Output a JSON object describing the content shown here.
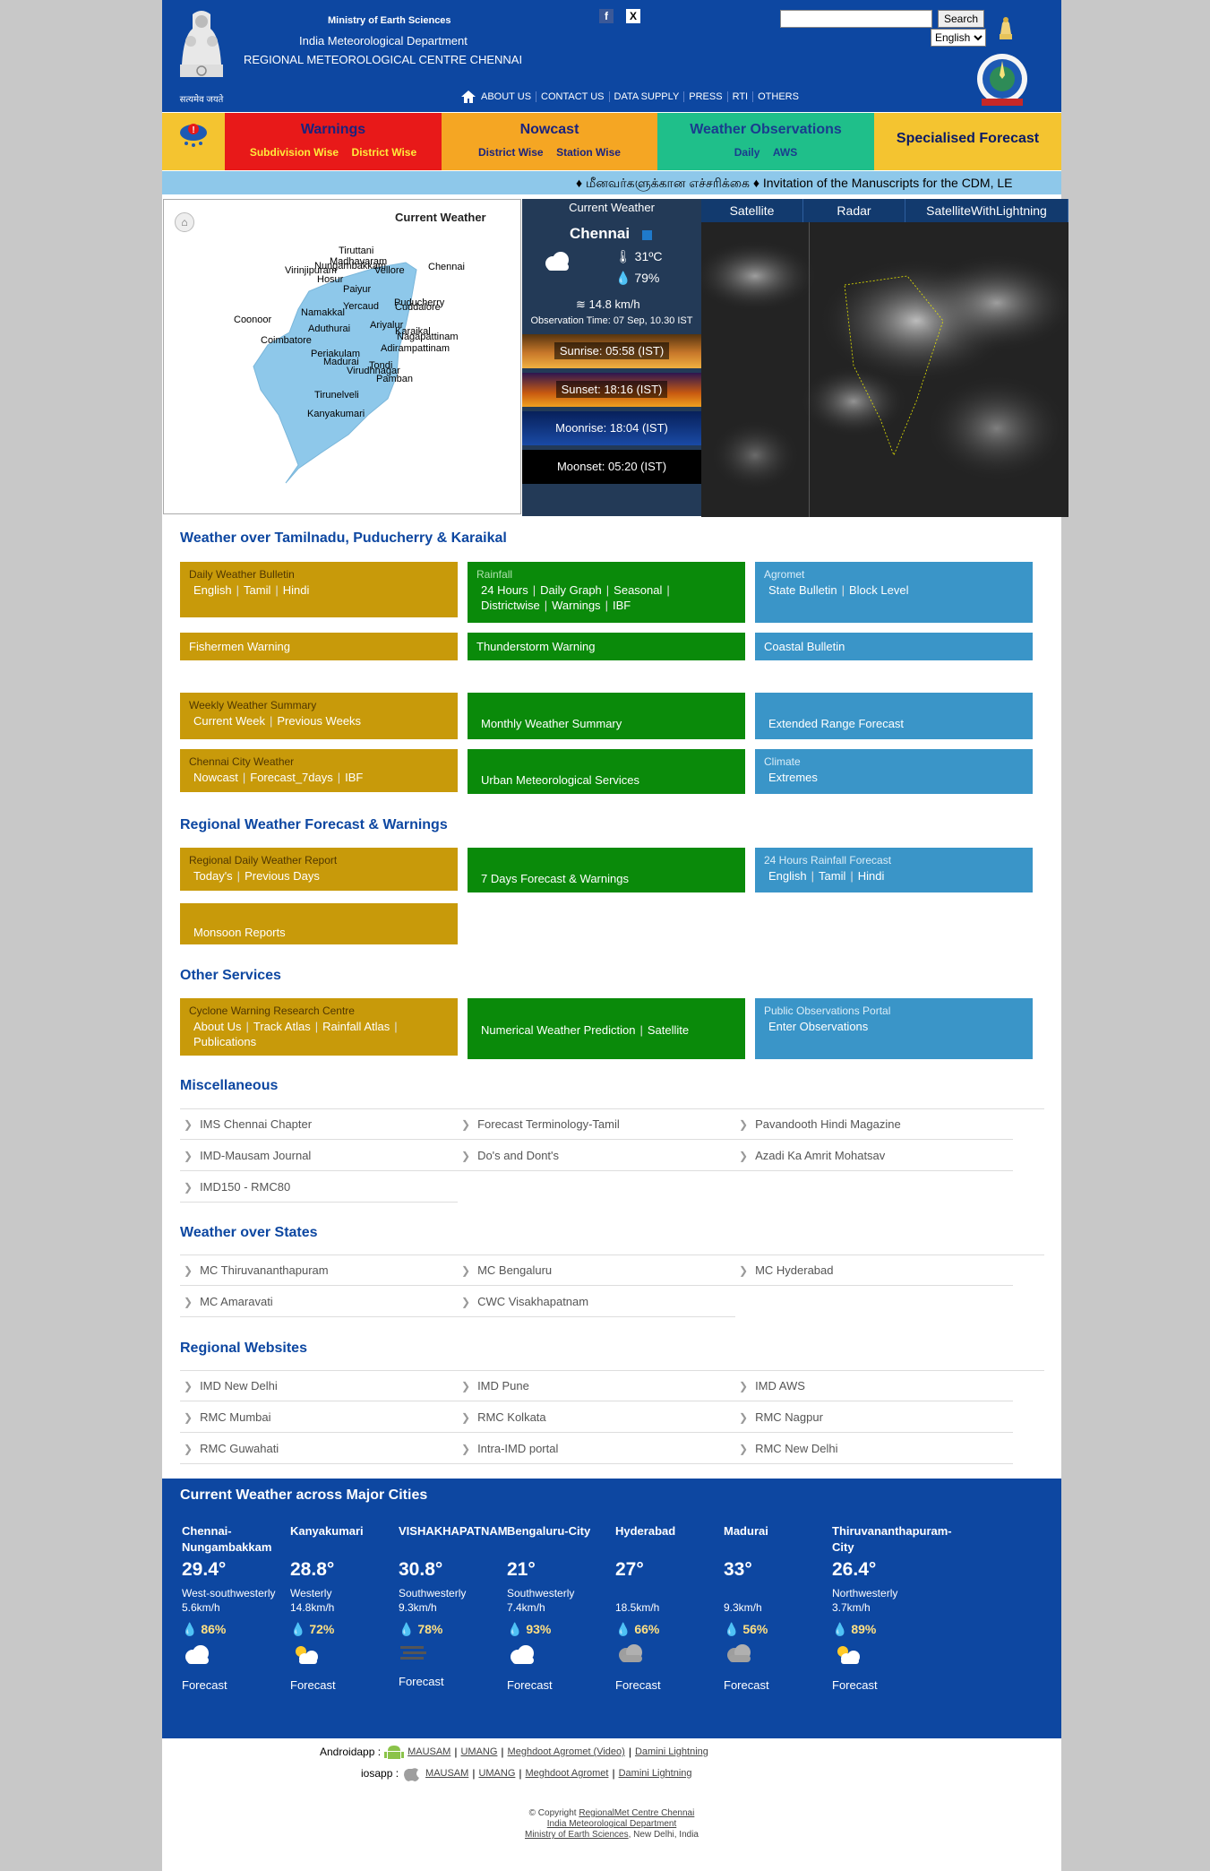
{
  "header": {
    "ministry": "Ministry of Earth Sciences",
    "department": "India Meteorological Department",
    "centre": "REGIONAL METEOROLOGICAL CENTRE CHENNAI",
    "emblem_motto": "सत्यमेव जयते",
    "social": [
      {
        "icon": "facebook-icon",
        "glyph": "f"
      },
      {
        "icon": "x-twitter-icon",
        "glyph": "X"
      }
    ],
    "search_button": "Search",
    "language": "English",
    "nav": [
      "ABOUT US",
      "CONTACT US",
      "DATA SUPPLY",
      "PRESS",
      "RTI",
      "OTHERS"
    ]
  },
  "categories": [
    {
      "title": "Warnings",
      "links": [
        "Subdivision Wise",
        "District Wise"
      ],
      "color": "#e81919"
    },
    {
      "title": "Nowcast",
      "links": [
        "District Wise",
        "Station Wise"
      ],
      "color": "#f5a623"
    },
    {
      "title": "Weather Observations",
      "links": [
        "Daily",
        "AWS"
      ],
      "color": "#1fbf8a"
    },
    {
      "title": "Specialised Forecast",
      "links": [],
      "color": "#f4c430"
    }
  ],
  "ticker": "♦ மீனவர்களுக்கான எச்சரிக்கை   ♦ Invitation of the Manuscripts for the CDM, LE",
  "map": {
    "title": "Current Weather",
    "places": [
      "Tiruttani",
      "Madhavaram",
      "Nungambakkam",
      "Virinjipuram",
      "Vellore",
      "Chennai",
      "Hosur",
      "Paiyur",
      "Yercaud",
      "Puducherry",
      "Cuddalore",
      "Namakkal",
      "Coonoor",
      "Ariyalur",
      "Aduthurai",
      "Karaikal",
      "Nagapattinam",
      "Coimbatore",
      "Adirampattinam",
      "Periakulam",
      "Madurai",
      "Tondi",
      "Virudhnagar",
      "Pamban",
      "Tirunelveli",
      "Kanyakumari"
    ]
  },
  "current": {
    "title": "Current Weather",
    "city": "Chennai",
    "temp": "31ºC",
    "humidity": "79%",
    "wind": "14.8 km/h",
    "obs_time": "Observation Time: 07 Sep, 10.30 IST",
    "sunrise": "Sunrise: 05:58 (IST)",
    "sunset": "Sunset: 18:16 (IST)",
    "moonrise": "Moonrise: 18:04 (IST)",
    "moonset": "Moonset: 05:20 (IST)"
  },
  "sat_tabs": [
    "Satellite",
    "Radar",
    "SatelliteWithLightning"
  ],
  "sections": {
    "tamilnadu": "Weather over Tamilnadu, Puducherry & Karaikal",
    "regional": "Regional Weather Forecast & Warnings",
    "other": "Other Services",
    "misc": "Miscellaneous",
    "states": "Weather over States",
    "websites": "Regional Websites"
  },
  "tn_boxes": {
    "daily_bulletin": {
      "head": "Daily Weather Bulletin",
      "links": [
        "English",
        "Tamil",
        "Hindi"
      ]
    },
    "rainfall": {
      "head": "Rainfall",
      "links": [
        "24 Hours",
        "Daily Graph",
        "Seasonal",
        "Districtwise",
        "Warnings",
        "IBF"
      ]
    },
    "agromet": {
      "head": "Agromet",
      "links": [
        "State Bulletin",
        "Block Level"
      ]
    },
    "fishermen": "Fishermen Warning",
    "thunderstorm": "Thunderstorm Warning",
    "coastal": "Coastal Bulletin",
    "weekly": {
      "head": "Weekly Weather Summary",
      "links": [
        "Current Week",
        "Previous Weeks"
      ]
    },
    "monthly": "Monthly Weather Summary",
    "extended": "Extended Range Forecast",
    "city": {
      "head": "Chennai City Weather",
      "links": [
        "Nowcast",
        "Forecast_7days",
        "IBF"
      ]
    },
    "urban": "Urban Meteorological Services",
    "climate": {
      "head": "Climate",
      "links": [
        "Extremes"
      ]
    }
  },
  "regional_boxes": {
    "report": {
      "head": "Regional Daily Weather Report",
      "links": [
        "Today's",
        "Previous Days"
      ]
    },
    "seven": "7 Days Forecast & Warnings",
    "rain24": {
      "head": "24 Hours Rainfall Forecast",
      "links": [
        "English",
        "Tamil",
        "Hindi"
      ]
    },
    "monsoon": "Monsoon Reports"
  },
  "other_boxes": {
    "cwrc": {
      "head": "Cyclone Warning Research Centre",
      "links": [
        "About Us",
        "Track Atlas",
        "Rainfall Atlas",
        "Publications"
      ]
    },
    "nwp": {
      "links": [
        "Numerical Weather Prediction",
        "Satellite"
      ]
    },
    "pop": {
      "head": "Public Observations Portal",
      "links": [
        "Enter Observations"
      ]
    }
  },
  "misc": [
    "IMS Chennai Chapter",
    "Forecast Terminology-Tamil",
    "Pavandooth Hindi Magazine",
    "IMD-Mausam Journal",
    "Do's and Dont's",
    "Azadi Ka Amrit Mohatsav",
    "IMD150 - RMC80"
  ],
  "states": [
    "MC Thiruvananthapuram",
    "MC Bengaluru",
    "MC Hyderabad",
    "MC Amaravati",
    "CWC Visakhapatnam"
  ],
  "websites": [
    "IMD New Delhi",
    "IMD Pune",
    "IMD AWS",
    "RMC Mumbai",
    "RMC Kolkata",
    "RMC Nagpur",
    "RMC Guwahati",
    "Intra-IMD portal",
    "RMC New Delhi"
  ],
  "cities_title": "Current Weather across Major Cities",
  "cities": [
    {
      "name": "Chennai-Nungambakkam",
      "temp": "29.4°",
      "wind_dir": "West-southwesterly",
      "wind_speed": "5.6km/h",
      "humidity": "86%",
      "icon": "partly-cloudy-icon",
      "forecast": "Forecast"
    },
    {
      "name": "Kanyakumari",
      "temp": "28.8°",
      "wind_dir": "Westerly",
      "wind_speed": "14.8km/h",
      "humidity": "72%",
      "icon": "sun-cloud-icon",
      "forecast": "Forecast"
    },
    {
      "name": "VISHAKHAPATNAM",
      "temp": "30.8°",
      "wind_dir": "Southwesterly",
      "wind_speed": "9.3km/h",
      "humidity": "78%",
      "icon": "haze-icon",
      "forecast": "Forecast"
    },
    {
      "name": "Bengaluru-City",
      "temp": "21°",
      "wind_dir": "Southwesterly",
      "wind_speed": "7.4km/h",
      "humidity": "93%",
      "icon": "partly-cloudy-icon",
      "forecast": "Forecast"
    },
    {
      "name": "Hyderabad",
      "temp": "27°",
      "wind_dir": "",
      "wind_speed": "18.5km/h",
      "humidity": "66%",
      "icon": "rain-cloud-icon",
      "forecast": "Forecast"
    },
    {
      "name": "Madurai",
      "temp": "33°",
      "wind_dir": "",
      "wind_speed": "9.3km/h",
      "humidity": "56%",
      "icon": "rain-cloud-icon",
      "forecast": "Forecast"
    },
    {
      "name": "Thiruvananthapuram-City",
      "temp": "26.4°",
      "wind_dir": "Northwesterly",
      "wind_speed": "3.7km/h",
      "humidity": "89%",
      "icon": "sun-cloud-icon",
      "forecast": "Forecast"
    }
  ],
  "apps": {
    "android_label": "Androidapp :",
    "android_links": [
      "MAUSAM",
      "UMANG",
      "Meghdoot Agromet (Video)",
      "Damini Lightning"
    ],
    "ios_label": "iosapp :",
    "ios_links": [
      "MAUSAM",
      "UMANG",
      "Meghdoot Agromet",
      "Damini Lightning"
    ]
  },
  "footer": {
    "line1_prefix": "© Copyright",
    "line1_link": "RegionalMet Centre Chennai",
    "line2": "India Meteorological Department",
    "line3_link": "Ministry of Earth Sciences",
    "line3_suffix": ", New Delhi, India"
  }
}
